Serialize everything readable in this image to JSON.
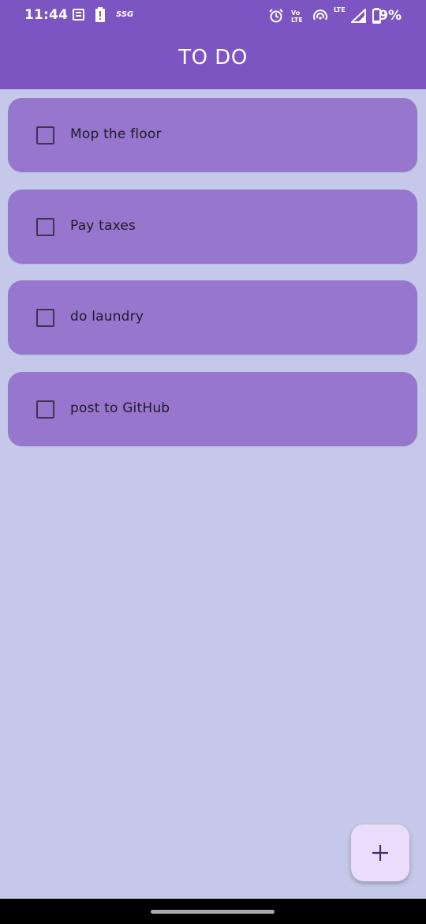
{
  "status_bar": {
    "time": "11:44",
    "network_label": "SSG",
    "lte_label": "LTE",
    "battery": "9%"
  },
  "header": {
    "title": "TO DO"
  },
  "todos": [
    {
      "label": "Mop the floor",
      "checked": false
    },
    {
      "label": "Pay taxes",
      "checked": false
    },
    {
      "label": "do laundry",
      "checked": false
    },
    {
      "label": "post to GitHub",
      "checked": false
    }
  ],
  "fab": {
    "icon": "add-icon"
  },
  "colors": {
    "appbar": "#7d55c2",
    "background": "#c5c8e8",
    "card": "#9677cd",
    "fab": "#ecdcfc"
  }
}
